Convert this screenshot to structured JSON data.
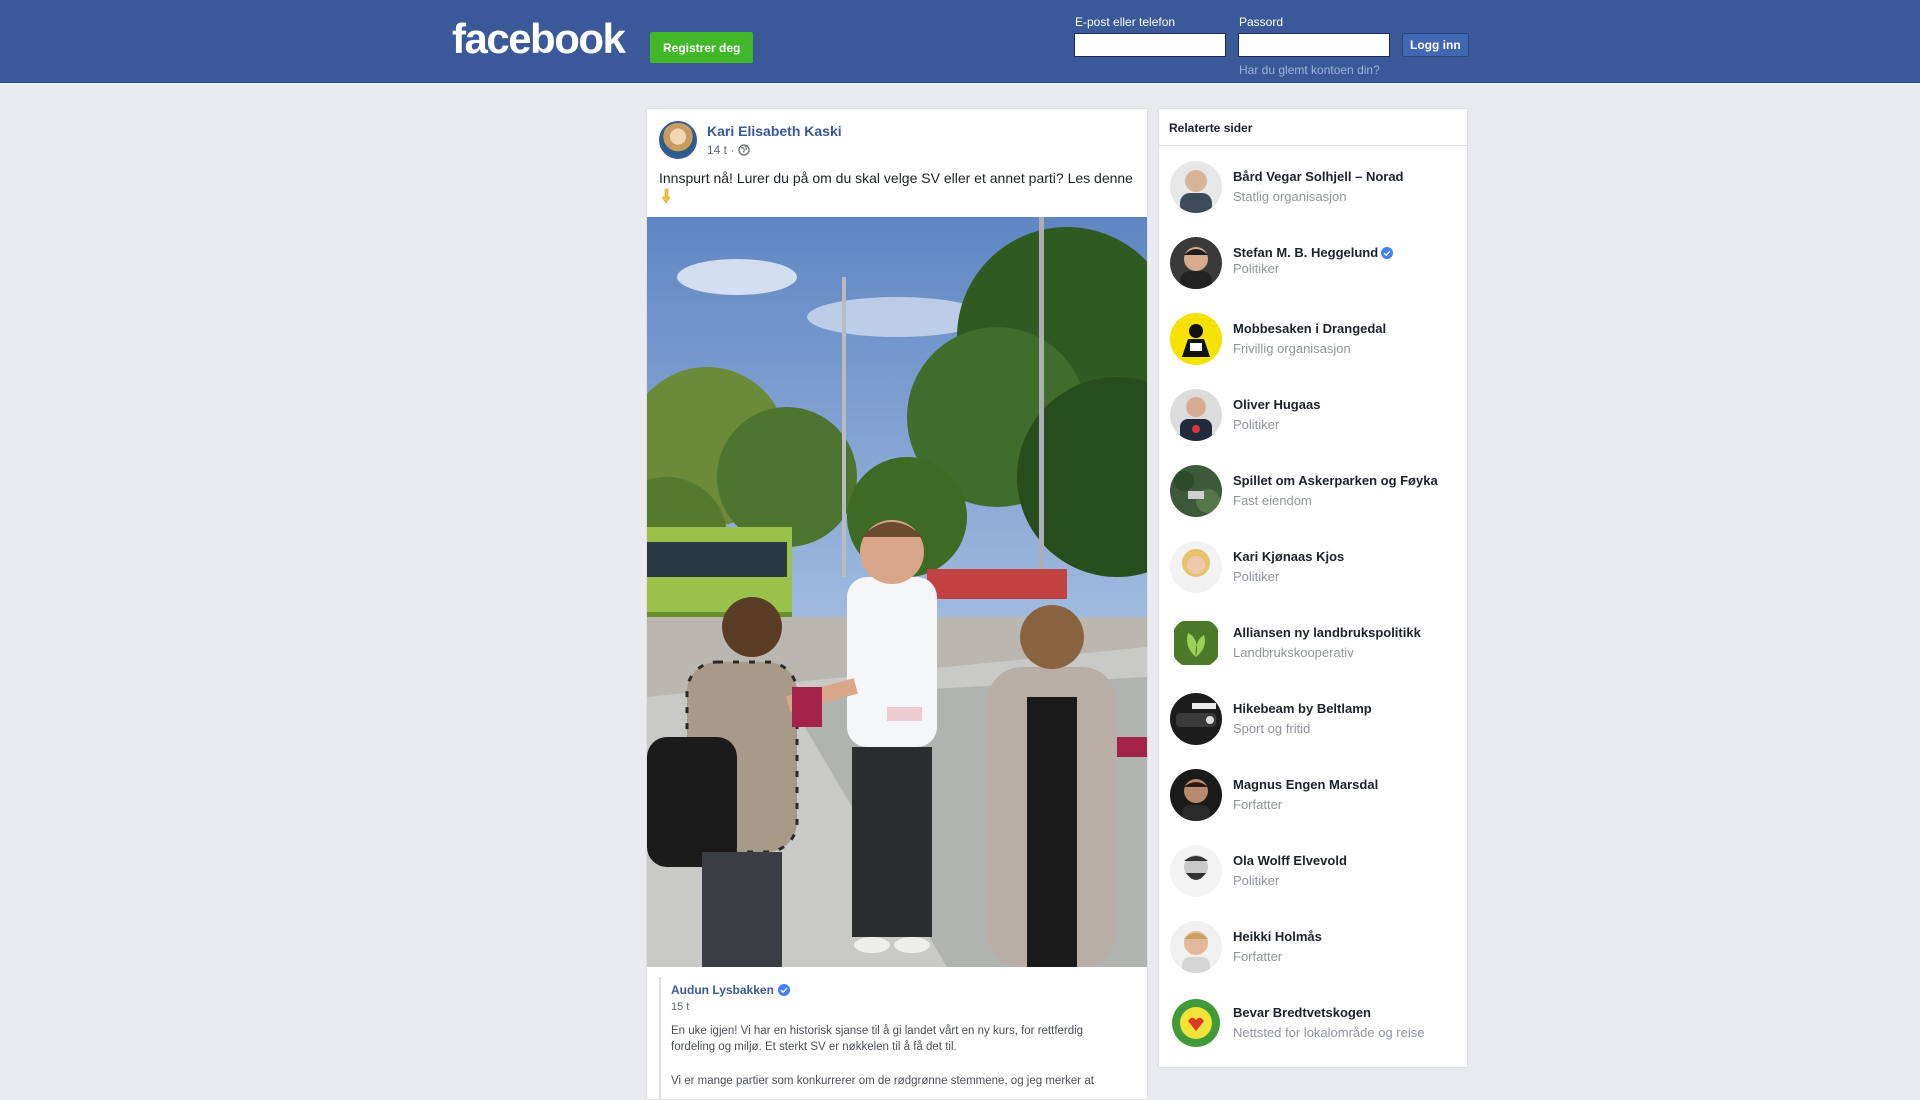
{
  "header": {
    "logo": "facebook",
    "register_label": "Registrer deg",
    "email_label": "E-post eller telefon",
    "password_label": "Passord",
    "login_label": "Logg inn",
    "forgot_label": "Har du glemt kontoen din?"
  },
  "post": {
    "author": "Kari Elisabeth Kaski",
    "time": "14 t ·",
    "text": "Innspurt nå! Lurer du på om du skal velge SV eller et annet parti? Les denne",
    "shared": {
      "author": "Audun Lysbakken",
      "time": "15 t",
      "p1": "En uke igjen! Vi har en historisk sjanse til å gi landet vårt en ny kurs, for rettferdig fordeling og miljø. Et sterkt SV er nøkkelen til å få det til.",
      "p2": "Vi er mange partier som konkurrerer om de rødgrønne stemmene, og jeg merker at"
    }
  },
  "sidebar": {
    "title": "Relaterte sider",
    "items": [
      {
        "name": "Bård Vegar Solhjell – Norad",
        "category": "Statlig organisasjon",
        "verified": false,
        "avatar": "bald-man"
      },
      {
        "name": "Stefan M. B. Heggelund",
        "category": "Politiker",
        "verified": true,
        "avatar": "man-dark-hair"
      },
      {
        "name": "Mobbesaken i Drangedal",
        "category": "Frivillig organisasjon",
        "verified": false,
        "avatar": "yellow-logo"
      },
      {
        "name": "Oliver Hugaas",
        "category": "Politiker",
        "verified": false,
        "avatar": "man-suit"
      },
      {
        "name": "Spillet om Askerparken og Føyka",
        "category": "Fast eiendom",
        "verified": false,
        "avatar": "aerial-park"
      },
      {
        "name": "Kari Kjønaas Kjos",
        "category": "Politiker",
        "verified": false,
        "avatar": "blonde-woman"
      },
      {
        "name": "Alliansen ny landbrukspolitikk",
        "category": "Landbrukskooperativ",
        "verified": false,
        "avatar": "green-leaf"
      },
      {
        "name": "Hikebeam by Beltlamp",
        "category": "Sport og fritid",
        "verified": false,
        "avatar": "headlamp"
      },
      {
        "name": "Magnus Engen Marsdal",
        "category": "Forfatter",
        "verified": false,
        "avatar": "man-dark"
      },
      {
        "name": "Ola Wolff Elvevold",
        "category": "Politiker",
        "verified": false,
        "avatar": "bw-man"
      },
      {
        "name": "Heikki Holmås",
        "category": "Forfatter",
        "verified": false,
        "avatar": "blond-man"
      },
      {
        "name": "Bevar Bredtvetskogen",
        "category": "Nettsted for lokalområde og reise",
        "verified": false,
        "avatar": "green-badge"
      }
    ]
  }
}
